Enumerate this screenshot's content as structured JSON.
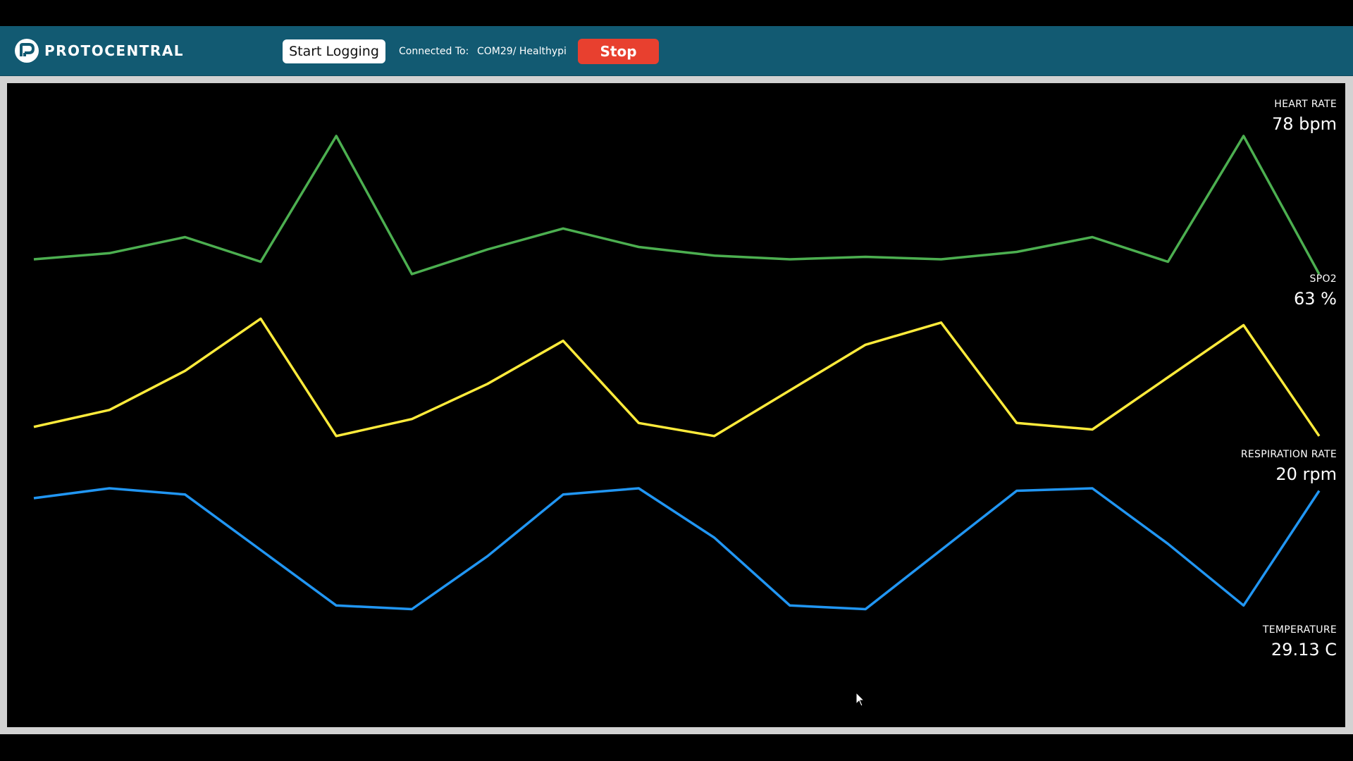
{
  "header": {
    "brand": "PROTOCENTRAL",
    "start_logging_label": "Start Logging",
    "connected_label": "Connected To:",
    "connected_value": "COM29/ Healthypi",
    "stop_label": "Stop"
  },
  "readouts": {
    "heart_rate": {
      "label": "HEART RATE",
      "value": "78 bpm"
    },
    "spo2": {
      "label": "SPO2",
      "value": "63 %"
    },
    "respiration": {
      "label": "RESPIRATION RATE",
      "value": "20 rpm"
    },
    "temperature": {
      "label": "TEMPERATURE",
      "value": "29.13 C"
    }
  },
  "colors": {
    "topbar": "#125a72",
    "ecg": "#4caf50",
    "ppg": "#ffeb3b",
    "resp": "#2196f3",
    "stop": "#e8402f"
  },
  "icons": {
    "logo": "protocentral-logo-icon",
    "cursor": "mouse-pointer-icon"
  },
  "chart_data": [
    {
      "type": "line",
      "series": [
        {
          "values": [
            0.0,
            0.05,
            0.18,
            -0.02,
            1.0,
            -0.12,
            0.08,
            0.25,
            0.1,
            0.03,
            0.0,
            0.02,
            0.0,
            0.06,
            0.18,
            -0.02,
            1.0,
            -0.12
          ]
        }
      ]
    },
    {
      "type": "line",
      "series": [
        {
          "values": [
            0.12,
            0.25,
            0.55,
            0.95,
            0.05,
            0.18,
            0.45,
            0.78,
            0.15,
            0.05,
            0.4,
            0.75,
            0.92,
            0.15,
            0.1,
            0.5,
            0.9,
            0.05
          ]
        }
      ]
    },
    {
      "type": "line",
      "series": [
        {
          "values": [
            0.92,
            1.0,
            0.95,
            0.5,
            0.05,
            0.02,
            0.45,
            0.95,
            1.0,
            0.6,
            0.05,
            0.02,
            0.5,
            0.98,
            1.0,
            0.55,
            0.05,
            0.98
          ]
        }
      ]
    }
  ]
}
